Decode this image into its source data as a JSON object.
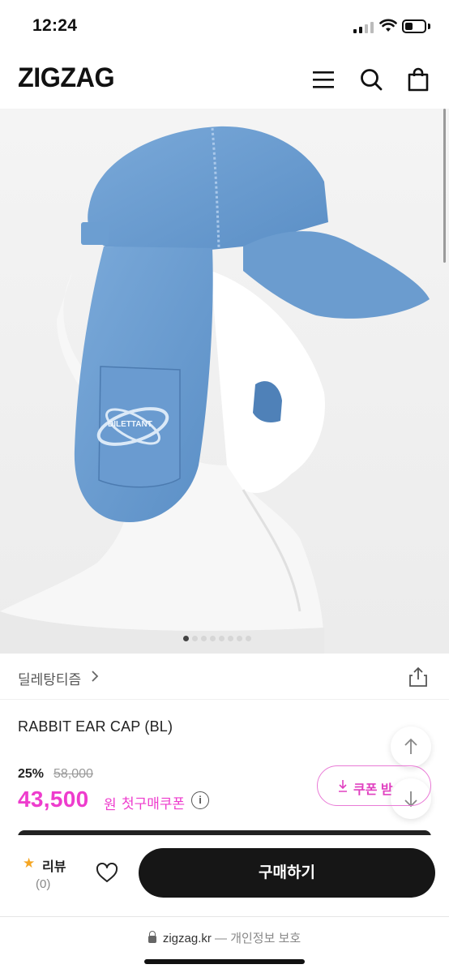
{
  "status_bar": {
    "time": "12:24"
  },
  "header": {
    "logo": "ZIGZAG",
    "icons": [
      "menu-icon",
      "search-icon",
      "shopping-bag-icon"
    ]
  },
  "hero": {
    "image_alt": "Blue rabbit ear cap on white mannequin",
    "logo_text": "DILETTANT",
    "carousel": {
      "total": 8,
      "active": 1
    }
  },
  "store": {
    "name": "딜레탕티즘"
  },
  "product": {
    "title": "RABBIT EAR CAP (BL)",
    "discount": "25%",
    "original_price": "58,000",
    "price": "43,500",
    "currency": "원",
    "first_purchase_coupon": "첫구매쿠폰",
    "coupon_button": "쿠폰 받"
  },
  "bottom_bar": {
    "review_label": "리뷰",
    "review_count": "(0)",
    "buy_label": "구매하기"
  },
  "footer": {
    "domain": "zigzag.kr",
    "suffix": "— 개인정보 보호"
  },
  "colors": {
    "accent": "#ee3ccd",
    "buy_button": "#161616",
    "star": "#f5a623"
  }
}
